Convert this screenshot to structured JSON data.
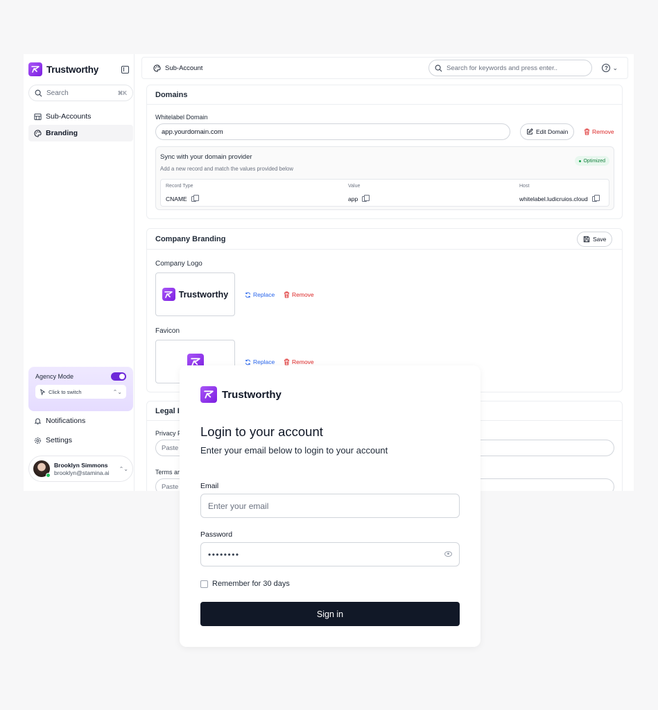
{
  "app": {
    "name": "Trustworthy"
  },
  "sidebar": {
    "search_placeholder": "Search",
    "search_shortcut": "⌘K",
    "items": [
      {
        "label": "Sub-Accounts",
        "icon": "building-icon"
      },
      {
        "label": "Branding",
        "icon": "palette-icon",
        "active": true
      }
    ],
    "agency": {
      "label": "Agency Mode",
      "enabled": true,
      "switch_label": "Click to switch"
    },
    "bottom_items": [
      {
        "label": "Notifications",
        "icon": "bell-icon"
      },
      {
        "label": "Settings",
        "icon": "gear-icon"
      }
    ],
    "user": {
      "name": "Brooklyn Simmons",
      "email": "brooklyn@stamina.ai"
    }
  },
  "topbar": {
    "breadcrumb": "Sub-Account",
    "search_placeholder": "Search for keywords and press enter.."
  },
  "domains": {
    "title": "Domains",
    "whitelabel_label": "Whitelabel Domain",
    "domain_value": "app.yourdomain.com",
    "edit_label": "Edit Domain",
    "remove_label": "Remove",
    "sync_title": "Sync with your domain provider",
    "sync_sub": "Add a new record and match the values provided below",
    "status": "Optimized",
    "columns": [
      "Record Type",
      "Value",
      "Host"
    ],
    "row": [
      "CNAME",
      "app",
      "whitelabel.ludicruios.cloud"
    ]
  },
  "branding": {
    "title": "Company Branding",
    "save_label": "Save",
    "logo_label": "Company Logo",
    "favicon_label": "Favicon",
    "replace_label": "Replace",
    "remove_label": "Remove"
  },
  "legal": {
    "title_partial": "Legal I",
    "privacy_label_partial": "Privacy P",
    "privacy_placeholder_partial": "Paste",
    "terms_label_partial": "Terms ar",
    "terms_placeholder_partial": "Paste"
  },
  "login": {
    "brand": "Trustworthy",
    "title": "Login to your account",
    "subtitle": "Enter your email below to login to your account",
    "email_label": "Email",
    "email_placeholder": "Enter your email",
    "password_label": "Password",
    "password_value": "••••••••",
    "remember_label": "Remember for 30 days",
    "signin_label": "Sign in"
  },
  "colors": {
    "brand": "#7c1fe0",
    "accent_toggle": "#6d28d9",
    "danger": "#dc2626",
    "link": "#2563eb",
    "success": "#15803d",
    "primary_button": "#111827"
  }
}
